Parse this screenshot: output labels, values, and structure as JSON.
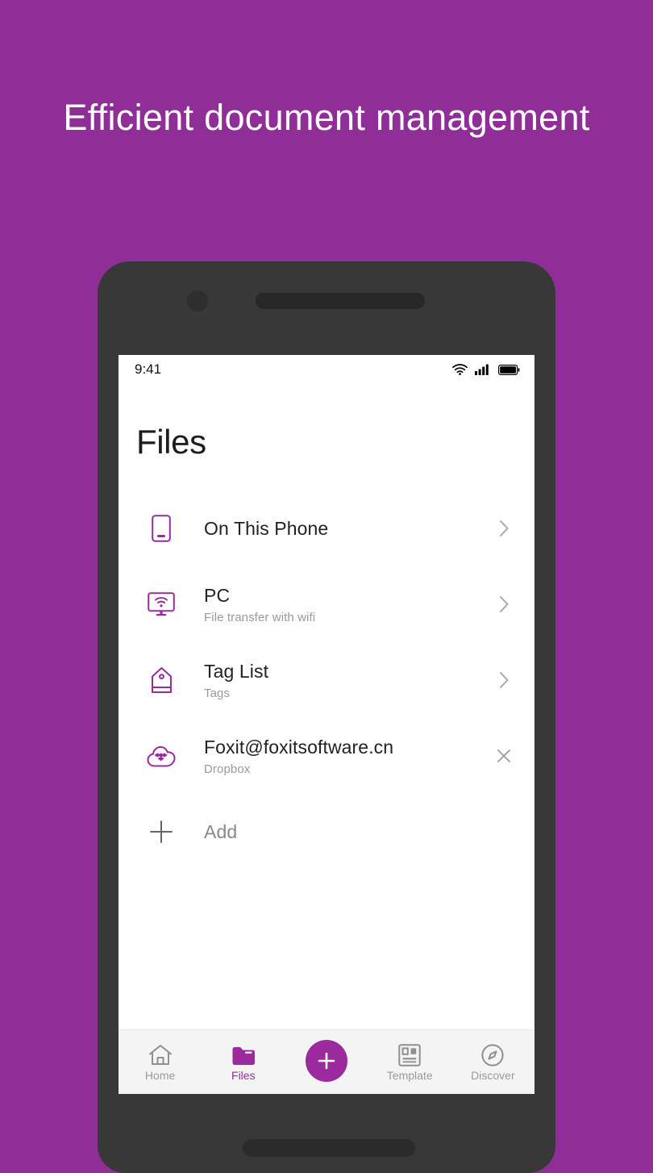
{
  "headline": "Efficient document management",
  "colors": {
    "background_purple": "#8f2e96",
    "accent_purple": "#9a2a9e",
    "device_frame": "#383838",
    "screen_white": "#ffffff",
    "navbar_grey": "#f4f4f4",
    "muted_text": "#9a9a9a"
  },
  "statusbar": {
    "time": "9:41",
    "icons": [
      "wifi-icon",
      "cellular-signal-icon",
      "battery-icon"
    ]
  },
  "screen": {
    "title": "Files",
    "items": [
      {
        "icon": "phone-icon",
        "title": "On This Phone",
        "subtitle": "",
        "action": "chevron-right-icon"
      },
      {
        "icon": "monitor-wifi-icon",
        "title": "PC",
        "subtitle": "File transfer with wifi",
        "action": "chevron-right-icon"
      },
      {
        "icon": "tag-icon",
        "title": "Tag List",
        "subtitle": "Tags",
        "action": "chevron-right-icon"
      },
      {
        "icon": "dropbox-cloud-icon",
        "title": "Foxit@foxitsoftware.cn",
        "subtitle": "Dropbox",
        "action": "close-icon"
      },
      {
        "icon": "plus-icon",
        "title": "Add",
        "subtitle": "",
        "action": ""
      }
    ]
  },
  "navbar": {
    "items": [
      {
        "label": "Home",
        "icon": "home-icon",
        "active": false
      },
      {
        "label": "Files",
        "icon": "folder-icon",
        "active": true
      },
      {
        "label": "Template",
        "icon": "template-icon",
        "active": false
      },
      {
        "label": "Discover",
        "icon": "compass-icon",
        "active": false
      }
    ],
    "fab": {
      "icon": "plus-icon",
      "label": ""
    }
  }
}
